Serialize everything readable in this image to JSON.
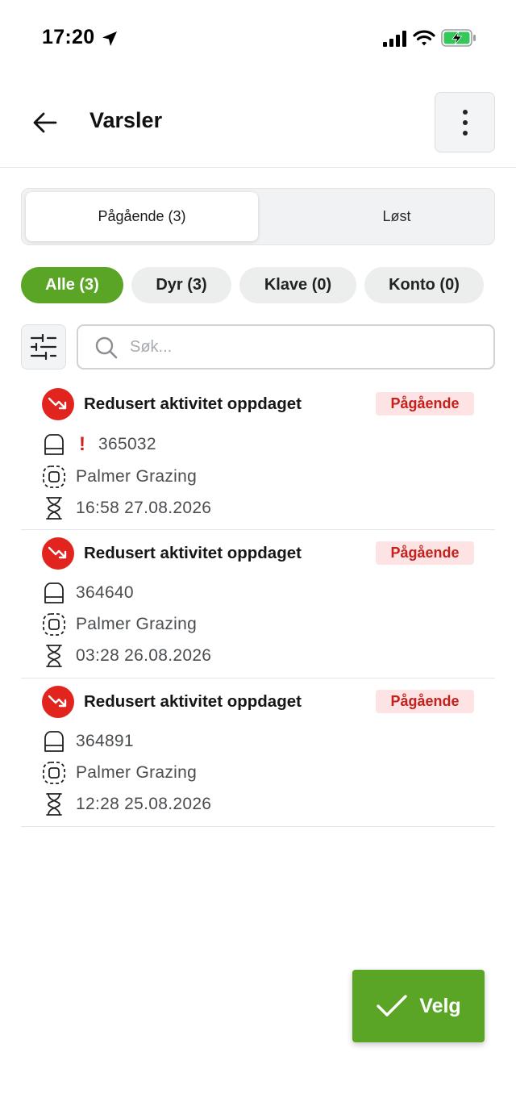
{
  "status_bar": {
    "time": "17:20"
  },
  "header": {
    "title": "Varsler"
  },
  "segments": [
    {
      "label": "Pågående (3)",
      "active": true
    },
    {
      "label": "Løst",
      "active": false
    }
  ],
  "chips": [
    {
      "label": "Alle (3)",
      "active": true
    },
    {
      "label": "Dyr (3)",
      "active": false
    },
    {
      "label": "Klave (0)",
      "active": false
    },
    {
      "label": "Konto (0)",
      "active": false
    }
  ],
  "search": {
    "placeholder": "Søk...",
    "value": ""
  },
  "alerts": [
    {
      "title": "Redusert aktivitet oppdaget",
      "status": "Pågående",
      "collar_id": "365032",
      "warning": "!",
      "farm": "Palmer Grazing",
      "time": "16:58 27.08.2026"
    },
    {
      "title": "Redusert aktivitet oppdaget",
      "status": "Pågående",
      "collar_id": "364640",
      "farm": "Palmer Grazing",
      "time": "03:28 26.08.2026"
    },
    {
      "title": "Redusert aktivitet oppdaget",
      "status": "Pågående",
      "collar_id": "364891",
      "farm": "Palmer Grazing",
      "time": "12:28 25.08.2026"
    }
  ],
  "fab": {
    "label": "Velg"
  },
  "colors": {
    "accent": "#5aa525",
    "alert": "#e1241d",
    "badge_bg": "#fde3e3",
    "badge_text": "#c4201c"
  },
  "icons": [
    "location-arrow-icon",
    "signal-icon",
    "wifi-icon",
    "battery-charging-icon",
    "back-arrow-icon",
    "more-vertical-icon",
    "filter-sliders-icon",
    "search-icon",
    "trend-down-icon",
    "collar-icon",
    "area-icon",
    "hourglass-icon",
    "checkmark-icon"
  ]
}
